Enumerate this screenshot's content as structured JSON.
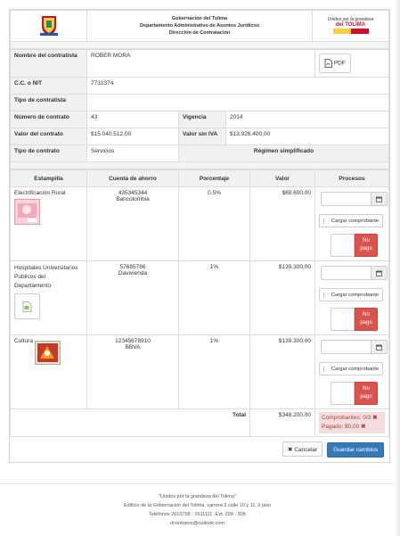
{
  "header": {
    "line1": "Gobernación del Tolima",
    "line2": "Departamento Administrativo de Asuntos Jurídicos",
    "line3": "Dirección de Contratación",
    "right_logo_line1": "Unidos por la grandeza",
    "right_logo_line2": "del TOLIMA"
  },
  "contract": {
    "nombre_label": "Nombre del contratista",
    "nombre_value": "ROBER MORA",
    "pdf_label": "PDF",
    "nit_label": "C.C. o NIT",
    "nit_value": "7731374",
    "tipo_contratista_label": "Tipo de contratista",
    "tipo_contratista_value": "",
    "numero_label": "Número de contrato",
    "numero_value": "43",
    "vigencia_label": "Vigencia",
    "vigencia_value": "2014",
    "valor_label": "Valor del contrato",
    "valor_value": "$15.040.512,00",
    "valor_sin_iva_label": "Valor sin IVA",
    "valor_sin_iva_value": "$13.926.400,00",
    "tipo_contrato_label": "Tipo de contrato",
    "tipo_contrato_value": "Servicios",
    "regimen_value": "Régimen simplificado"
  },
  "table": {
    "headers": [
      "Estampilla",
      "Cuenta de ahorro",
      "Porcentaje",
      "Valor",
      "Procesos"
    ],
    "rows": [
      {
        "estampilla": "Electrificación Rural",
        "cuenta": "435345344",
        "banco": "Bancolombia",
        "porcentaje": "0.5%",
        "valor": "$69.600,00"
      },
      {
        "estampilla": "Hospitales Universitarios Públicos del Departamento",
        "cuenta": "57685786",
        "banco": "Davivienda",
        "porcentaje": "1%",
        "valor": "$139.300,00"
      },
      {
        "estampilla": "Cultura",
        "cuenta": "12345678910",
        "banco": "BBVA",
        "porcentaje": "1%",
        "valor": "$139.300,00"
      }
    ],
    "upload_label": "Cargar comprobante",
    "pago_line1": "No",
    "pago_line2": "pago",
    "total_label": "Total",
    "total_value": "$348.200,00",
    "comprobantes": "Comprobantes: 0/3",
    "pagado": "Pagado: $0,00"
  },
  "actions": {
    "cancel_label": "Cancelar",
    "save_label": "Guardar cambios"
  },
  "footer": {
    "line1": "\"Unidos por la grandeza del Tolima\"",
    "line2": "Edificio de la Gobernación del Tolima, carrera 3 calle 10 y 11, 9 piso",
    "line3": "Teléfonos 2610758 - 2611111 -Ext. 209 - 305",
    "line4": "dcontratos@outlook.com"
  },
  "colors": {
    "primary": "#337ab7",
    "danger": "#d9534f",
    "danger_bg": "#f2dede"
  }
}
